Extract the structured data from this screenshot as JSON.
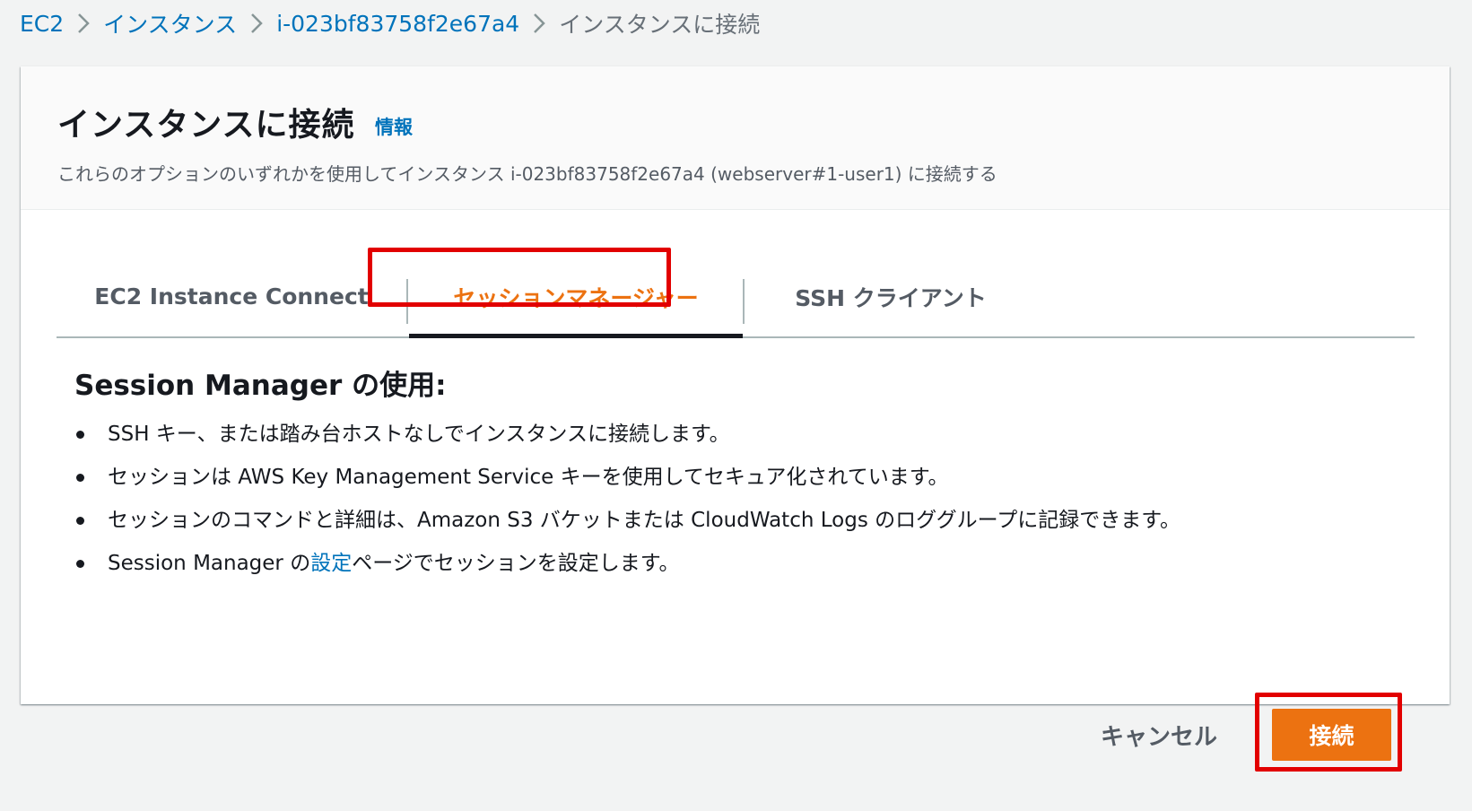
{
  "breadcrumb": {
    "items": [
      {
        "label": "EC2"
      },
      {
        "label": "インスタンス"
      },
      {
        "label": "i-023bf83758f2e67a4"
      }
    ],
    "current": "インスタンスに接続"
  },
  "panel": {
    "title": "インスタンスに接続",
    "info_link": "情報",
    "description": "これらのオプションのいずれかを使用してインスタンス i-023bf83758f2e67a4 (webserver#1-user1) に接続する"
  },
  "tabs": [
    {
      "label": "EC2 Instance Connect",
      "active": false
    },
    {
      "label": "セッションマネージャー",
      "active": true
    },
    {
      "label": "SSH クライアント",
      "active": false
    }
  ],
  "content": {
    "heading": "Session Manager の使用:",
    "bullets": [
      "SSH キー、または踏み台ホストなしでインスタンスに接続します。",
      "セッションは AWS Key Management Service キーを使用してセキュア化されています。",
      "セッションのコマンドと詳細は、Amazon S3 バケットまたは CloudWatch Logs のロググループに記録できます。"
    ],
    "bullet4": {
      "prefix": "Session Manager の",
      "link": "設定",
      "suffix": "ページでセッションを設定します。"
    }
  },
  "actions": {
    "cancel_label": "キャンセル",
    "connect_label": "接続"
  },
  "colors": {
    "link": "#0073bb",
    "accent": "#ec7211",
    "highlight": "#e20000"
  }
}
